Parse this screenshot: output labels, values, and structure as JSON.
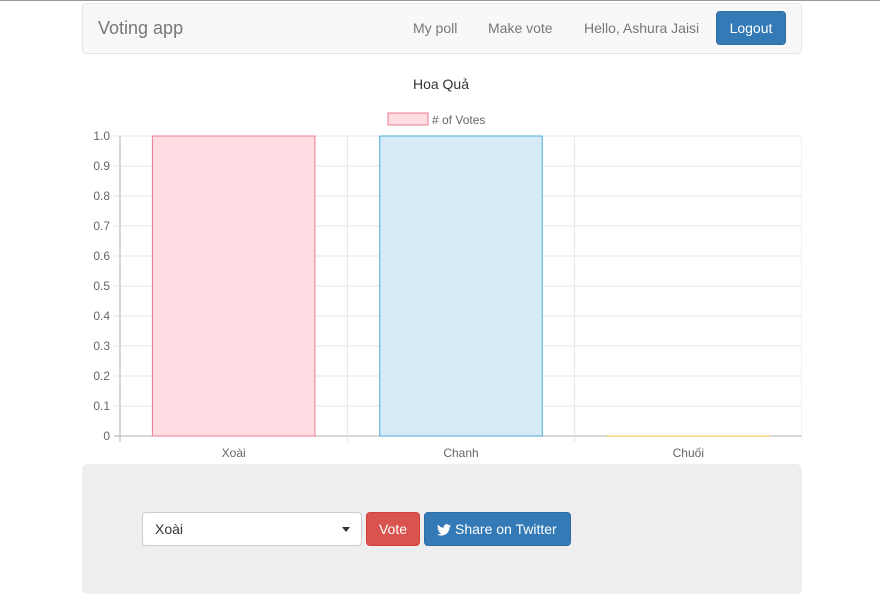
{
  "navbar": {
    "brand": "Voting app",
    "links": [
      "My poll",
      "Make vote"
    ],
    "greeting": "Hello, Ashura Jaisi",
    "logout_label": "Logout"
  },
  "chart_data": {
    "type": "bar",
    "title": "Hoa Quả",
    "categories": [
      "Xoài",
      "Chanh",
      "Chuối"
    ],
    "series": [
      {
        "name": "# of Votes",
        "values": [
          1,
          1,
          0
        ]
      }
    ],
    "ylim": [
      0,
      1.0
    ],
    "yticks": [
      "0",
      "0.1",
      "0.2",
      "0.3",
      "0.4",
      "0.5",
      "0.6",
      "0.7",
      "0.8",
      "0.9",
      "1.0"
    ],
    "legend_position": "top",
    "grid": true,
    "colors": {
      "fills": [
        "#ffdde3",
        "#d6eaf8",
        "#fff3d6"
      ],
      "strokes": [
        "#f07a92",
        "#4aaed8",
        "#f7d77a"
      ],
      "legend_fill": "#ffdde3",
      "legend_stroke": "#f07a92"
    }
  },
  "vote": {
    "selected_option": "Xoài",
    "vote_label": "Vote",
    "share_label": "Share on Twitter",
    "share_icon": "twitter-icon"
  },
  "colors": {
    "primary": "#337ab7",
    "danger": "#d9534f",
    "navbar_bg": "#f8f8f8",
    "panel_bg": "#eeeeee"
  }
}
